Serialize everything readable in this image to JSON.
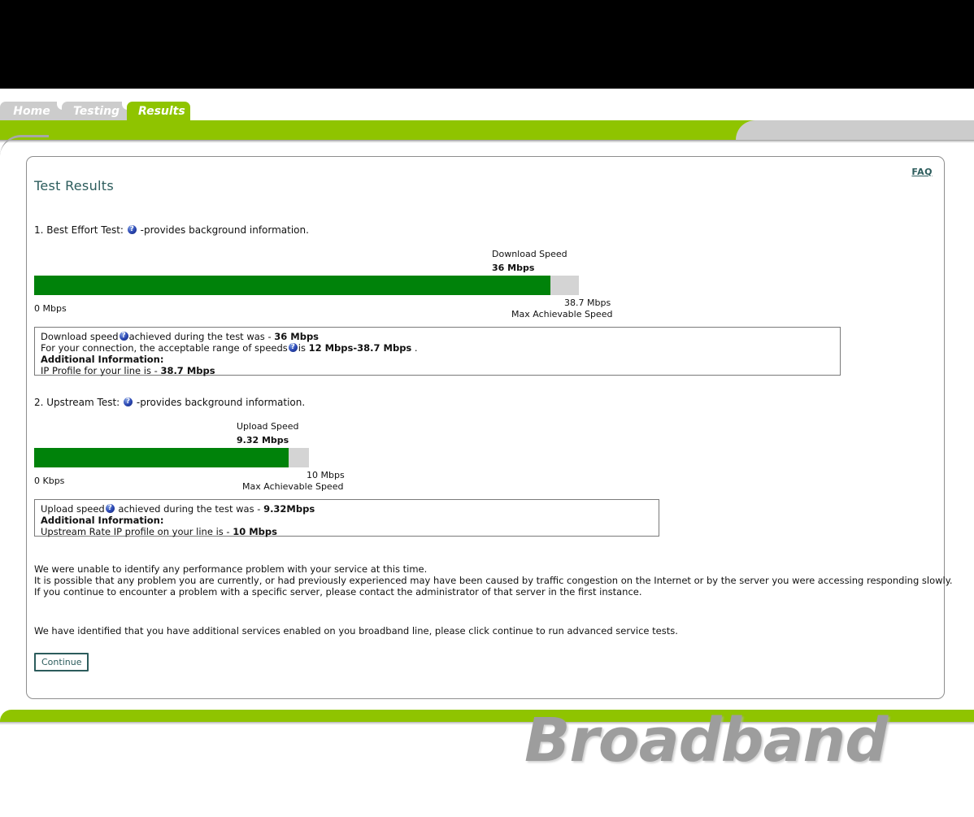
{
  "nav": {
    "tabs": [
      {
        "label": "Home",
        "active": false
      },
      {
        "label": "Testing",
        "active": false
      },
      {
        "label": "Results",
        "active": true
      }
    ]
  },
  "panel": {
    "faq_link": "FAQ",
    "title": "Test Results"
  },
  "section1": {
    "heading_prefix": "1. Best Effort Test:",
    "heading_suffix": "-provides background information.",
    "chart": {
      "caption_title": "Download Speed",
      "caption_value": "36 Mbps",
      "min_label": "0 Mbps",
      "max_value": "38.7 Mbps",
      "max_label": "Max Achievable Speed"
    },
    "info": {
      "line1_pre": "Download speed",
      "line1_mid": "achieved during the test was - ",
      "line1_value": "36 Mbps",
      "line2_pre": "For your connection, the acceptable range of speeds",
      "line2_mid": "is ",
      "line2_value": "12 Mbps-38.7 Mbps",
      "line2_post": " .",
      "line3": "Additional Information:",
      "line4_pre": "IP Profile for your line is - ",
      "line4_value": "38.7 Mbps"
    }
  },
  "section2": {
    "heading_prefix": "2. Upstream Test:",
    "heading_suffix": "-provides background information.",
    "chart": {
      "caption_title": "Upload Speed",
      "caption_value": "9.32 Mbps",
      "min_label": "0 Kbps",
      "max_value": "10 Mbps",
      "max_label": "Max Achievable Speed"
    },
    "info": {
      "line1_pre": "Upload speed",
      "line1_mid": " achieved during the test was - ",
      "line1_value": "9.32Mbps",
      "line2": "Additional Information:",
      "line3_pre": "Upstream Rate IP profile on your line is - ",
      "line3_value": "10 Mbps"
    }
  },
  "summary": {
    "line1": "We were unable to identify any performance problem with your service at this time.",
    "line2": "It is possible that any problem you are currently, or had previously experienced may have been caused by traffic congestion on the Internet or by the server you were accessing responding slowly.",
    "line3": "If you continue to encounter a problem with a specific server, please contact the administrator of that server in the first instance.",
    "line4": "We have identified that you have additional services enabled on you broadband line, please click continue to run advanced service tests.",
    "continue_label": "Continue"
  },
  "footer": {
    "brand": "Broadband"
  },
  "chart_data": [
    {
      "type": "bar",
      "title": "Download Speed",
      "orientation": "horizontal",
      "categories": [
        "Download Speed"
      ],
      "values": [
        36
      ],
      "value_label": "36 Mbps",
      "xlabel": "",
      "ylabel": "",
      "xlim": [
        0,
        38.7
      ],
      "axis_min_label": "0 Mbps",
      "axis_max_label": "38.7 Mbps",
      "axis_max_caption": "Max Achievable Speed",
      "fill_color": "#00820a",
      "track_color": "#d4d4d4",
      "grid": false,
      "legend": "none"
    },
    {
      "type": "bar",
      "title": "Upload Speed",
      "orientation": "horizontal",
      "categories": [
        "Upload Speed"
      ],
      "values": [
        9.32
      ],
      "value_label": "9.32 Mbps",
      "xlabel": "",
      "ylabel": "",
      "xlim": [
        0,
        10
      ],
      "axis_min_label": "0 Kbps",
      "axis_max_label": "10 Mbps",
      "axis_max_caption": "Max Achievable Speed",
      "fill_color": "#00820a",
      "track_color": "#d4d4d4",
      "grid": false,
      "legend": "none"
    }
  ],
  "colors": {
    "brand_green": "#8fc400",
    "bar_green": "#00820a",
    "track_gray": "#d4d4d4",
    "teal": "#2c5c5c",
    "tab_inactive": "#cccccc"
  }
}
